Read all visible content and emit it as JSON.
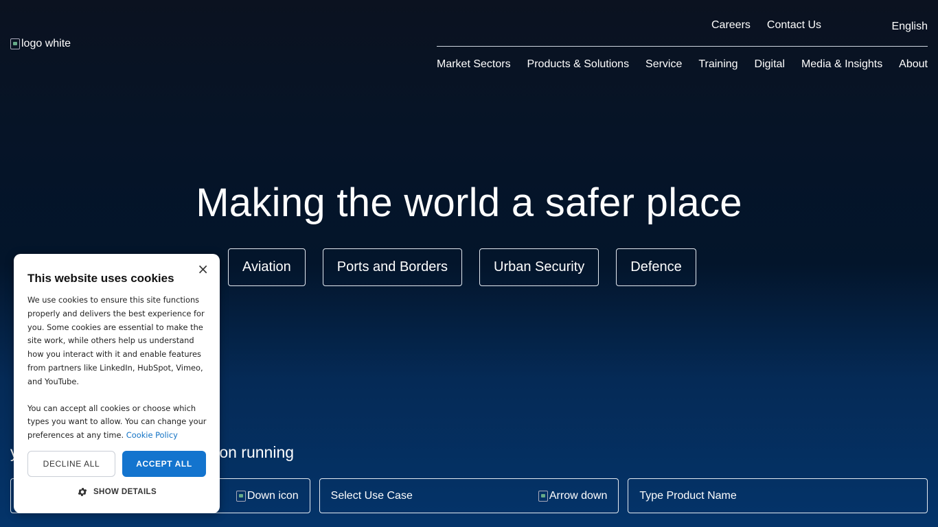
{
  "header": {
    "logo_alt": "logo white",
    "top_links": [
      "Careers",
      "Contact Us"
    ],
    "language": "English",
    "nav": [
      "Market Sectors",
      "Products & Solutions",
      "Service",
      "Training",
      "Digital",
      "Media & Insights",
      "About"
    ]
  },
  "hero": {
    "title": "Making the world a safer place",
    "sectors": [
      "Aviation",
      "Ports and Borders",
      "Urban Security",
      "Defence"
    ]
  },
  "finder": {
    "title": "you need to keep your operation running",
    "box1_icon_alt": "Down icon",
    "box2_label": "Select Use Case",
    "box2_icon_alt": "Arrow down",
    "box3_placeholder": "Type Product Name"
  },
  "cookie": {
    "title": "This website uses cookies",
    "body1": "We use cookies to ensure this site functions properly and delivers the best experience for you. Some cookies are essential to make the site work, while others help us understand how you interact with it and enable features from partners like LinkedIn, HubSpot, Vimeo, and YouTube.",
    "body2": "You can accept all cookies or choose which types you want to allow. You can change your preferences at any time.",
    "policy_link": "Cookie Policy",
    "decline": "DECLINE ALL",
    "accept": "ACCEPT ALL",
    "show_details": "SHOW DETAILS",
    "close": "×"
  },
  "colors": {
    "accent": "#1374ce",
    "link": "#1272c4"
  }
}
